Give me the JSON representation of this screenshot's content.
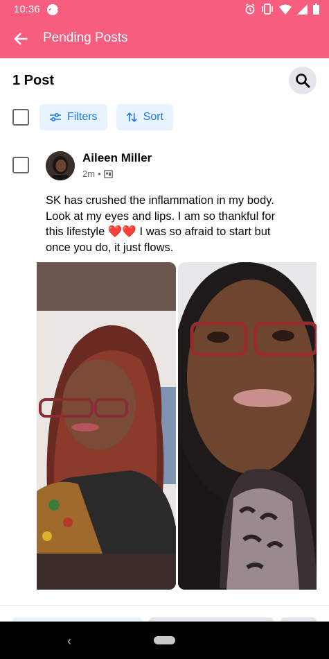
{
  "status_bar": {
    "time": "10:36",
    "icons": [
      "messenger-icon",
      "alarm-icon",
      "vibrate-icon",
      "wifi-icon",
      "signal-icon",
      "battery-icon"
    ]
  },
  "app_bar": {
    "title": "Pending Posts",
    "back_icon": "arrow-left-icon",
    "background": "#f75d7e"
  },
  "toolbar": {
    "count_label": "1 Post",
    "search_icon": "search-icon",
    "filters_label": "Filters",
    "sort_label": "Sort",
    "accent": "#1877f2"
  },
  "post": {
    "author": "Aileen Miller",
    "time": "2m",
    "separator": "•",
    "audience_icon": "group-icon",
    "text": "SK has crushed the inflammation in my body. Look at my eyes and lips. I am so thankful for this lifestyle ❤️❤️ I was so afraid to start but once you do, it just flows.",
    "photos": [
      "photo-before",
      "photo-after"
    ]
  },
  "system_nav": {
    "back_icon": "nav-back-icon",
    "home_icon": "nav-home-pill"
  }
}
